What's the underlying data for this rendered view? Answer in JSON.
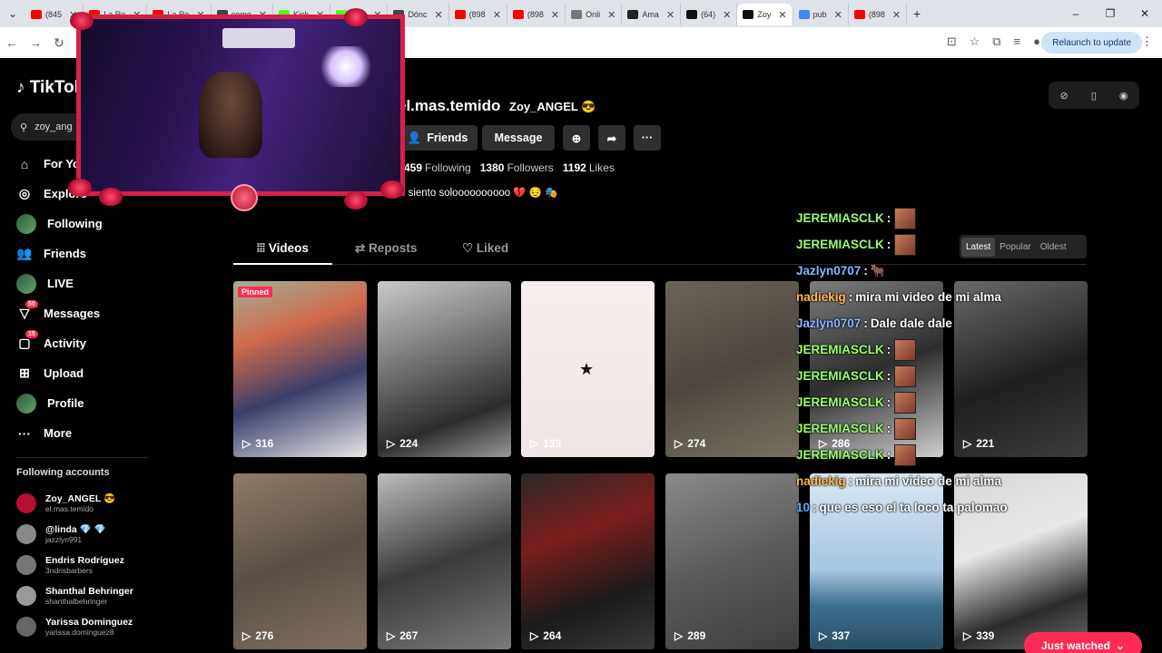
{
  "browser": {
    "tabs": [
      {
        "label": "(845",
        "color": "#ff0000"
      },
      {
        "label": "La Re",
        "color": "#ff0000"
      },
      {
        "label": "La Re",
        "color": "#ff0000"
      },
      {
        "label": "come",
        "color": "#444444"
      },
      {
        "label": "Kick",
        "color": "#53fc18"
      },
      {
        "label": "Kick",
        "color": "#53fc18"
      },
      {
        "label": "Dónc",
        "color": "#444444"
      },
      {
        "label": "(898",
        "color": "#ff0000"
      },
      {
        "label": "(898",
        "color": "#ff0000"
      },
      {
        "label": "Onli",
        "color": "#777777"
      },
      {
        "label": "Ama",
        "color": "#222222"
      },
      {
        "label": "(64)",
        "color": "#111111"
      },
      {
        "label": "Zoy",
        "color": "#111111",
        "active": true
      },
      {
        "label": "pub",
        "color": "#4285f4"
      },
      {
        "label": "(898",
        "color": "#ff0000"
      }
    ],
    "relaunch_label": "Relaunch to update"
  },
  "sidebar": {
    "logo": "TikTok",
    "search_value": "zoy_ang",
    "nav": [
      {
        "icon": "home-icon",
        "glyph": "⌂",
        "label": "For You"
      },
      {
        "icon": "explore-icon",
        "glyph": "◎",
        "label": "Explore"
      },
      {
        "icon": "following-icon",
        "glyph": "",
        "label": "Following"
      },
      {
        "icon": "friends-icon",
        "glyph": "👥",
        "label": "Friends"
      },
      {
        "icon": "live-icon",
        "glyph": "",
        "label": "LIVE"
      },
      {
        "icon": "messages-icon",
        "glyph": "▽",
        "label": "Messages",
        "badge": "50"
      },
      {
        "icon": "activity-icon",
        "glyph": "▢",
        "label": "Activity",
        "badge": "15"
      },
      {
        "icon": "upload-icon",
        "glyph": "⊞",
        "label": "Upload"
      },
      {
        "icon": "profile-icon",
        "glyph": "",
        "label": "Profile"
      },
      {
        "icon": "more-icon",
        "glyph": "···",
        "label": "More"
      }
    ],
    "following_title": "Following accounts",
    "following": [
      {
        "name": "Zoy_ANGEL 😎",
        "user": "el.mas.temido"
      },
      {
        "name": "@linda 💎 💎",
        "user": "jazzlyn991"
      },
      {
        "name": "Endris Rodríguez",
        "user": "3ndrisbarbers"
      },
      {
        "name": "Shanthal Behringer",
        "user": "shanthalbehringer"
      },
      {
        "name": "Yarissa Dominguez",
        "user": "yarissa.dominguez8"
      }
    ]
  },
  "profile": {
    "handle": "el.mas.temido",
    "nickname": "Zoy_ANGEL 😎",
    "friends_label": "Friends",
    "message_label": "Message",
    "following_count": "459",
    "following_label": "Following",
    "followers_count": "1380",
    "followers_label": "Followers",
    "likes_count": "1192",
    "likes_label": "Likes",
    "bio": "e siento soloooooooooo 💔 😔 🎭"
  },
  "tabs": {
    "videos": "Videos",
    "reposts": "Reposts",
    "liked": "Liked"
  },
  "sort": {
    "latest": "Latest",
    "popular": "Popular",
    "oldest": "Oldest"
  },
  "videos": [
    {
      "views": "316",
      "pinned": "Pinned",
      "bg": "linear-gradient(160deg,#a0b09a 0%,#d06a4a 30%,#3b3f6a 60%,#e6e6e6 100%)"
    },
    {
      "views": "224",
      "bg": "linear-gradient(160deg,#c9c9c9 0%,#6d6d6d 45%,#2c2c2c 75%,#9a9a9a 100%)"
    },
    {
      "views": "133",
      "bg": "linear-gradient(180deg,#f6eeee 0%,#f1e6e6 100%)",
      "star": "★"
    },
    {
      "views": "274",
      "bg": "linear-gradient(160deg,#6d6458 0%,#4d4740 50%,#77705f 100%)"
    },
    {
      "views": "286",
      "bg": "linear-gradient(160deg,#7d7d7d 0%,#2d2d2d 50%,#cfcfcf 100%)"
    },
    {
      "views": "221",
      "bg": "linear-gradient(160deg,#6a6a6a 0%,#1f1f1f 55%,#3c3c3c 100%)"
    },
    {
      "views": "276",
      "bg": "linear-gradient(160deg,#8d7c69 0%,#5a4f45 50%,#7f6f60 100%)"
    },
    {
      "views": "267",
      "bg": "linear-gradient(160deg,#bdbdbd 0%,#3a3a3a 50%,#7a7a7a 100%)"
    },
    {
      "views": "264",
      "bg": "linear-gradient(160deg,#2a2a2a 0%,#7c1d1d 35%,#1b1b1b 70%,#3a3a3a 100%)"
    },
    {
      "views": "289",
      "bg": "linear-gradient(160deg,#8a8a8a 0%,#5b5b5b 50%,#3e3e3e 100%)"
    },
    {
      "views": "337",
      "bg": "linear-gradient(180deg,#d8e7f3 0%,#a8c6e0 55%,#3c6f8e 75%,#2a4f66 100%)"
    },
    {
      "views": "339",
      "bg": "linear-gradient(160deg,#d6d6d6 0%,#e8e8e8 40%,#2b2b2b 75%,#6a6a6a 100%)"
    }
  ],
  "chat": [
    {
      "user": "JEREMIASCLK",
      "cls": "u1",
      "emote": true,
      "msg": ""
    },
    {
      "user": "JEREMIASCLK",
      "cls": "u1",
      "emote": true,
      "msg": ""
    },
    {
      "user": "Jazlyn0707",
      "cls": "u2",
      "emote": false,
      "msg": "🐂"
    },
    {
      "user": "nadiekig",
      "cls": "u3",
      "emote": false,
      "msg": "mira mi video de mi alma"
    },
    {
      "user": "Jazlyn0707",
      "cls": "u2",
      "emote": false,
      "msg": "Dale dale dale"
    },
    {
      "user": "JEREMIASCLK",
      "cls": "u1",
      "emote": true,
      "msg": ""
    },
    {
      "user": "JEREMIASCLK",
      "cls": "u1",
      "emote": true,
      "msg": ""
    },
    {
      "user": "JEREMIASCLK",
      "cls": "u1",
      "emote": true,
      "msg": ""
    },
    {
      "user": "JEREMIASCLK",
      "cls": "u1",
      "emote": true,
      "msg": ""
    },
    {
      "user": "JEREMIASCLK",
      "cls": "u1",
      "emote": true,
      "msg": ""
    },
    {
      "user": "nadiekig",
      "cls": "u3",
      "emote": false,
      "msg": "mira mi video de mi alma"
    },
    {
      "user": "10",
      "cls": "u4",
      "emote": false,
      "msg": "que es eso el ta loco ta palomao"
    }
  ],
  "just_watched": "Just watched"
}
